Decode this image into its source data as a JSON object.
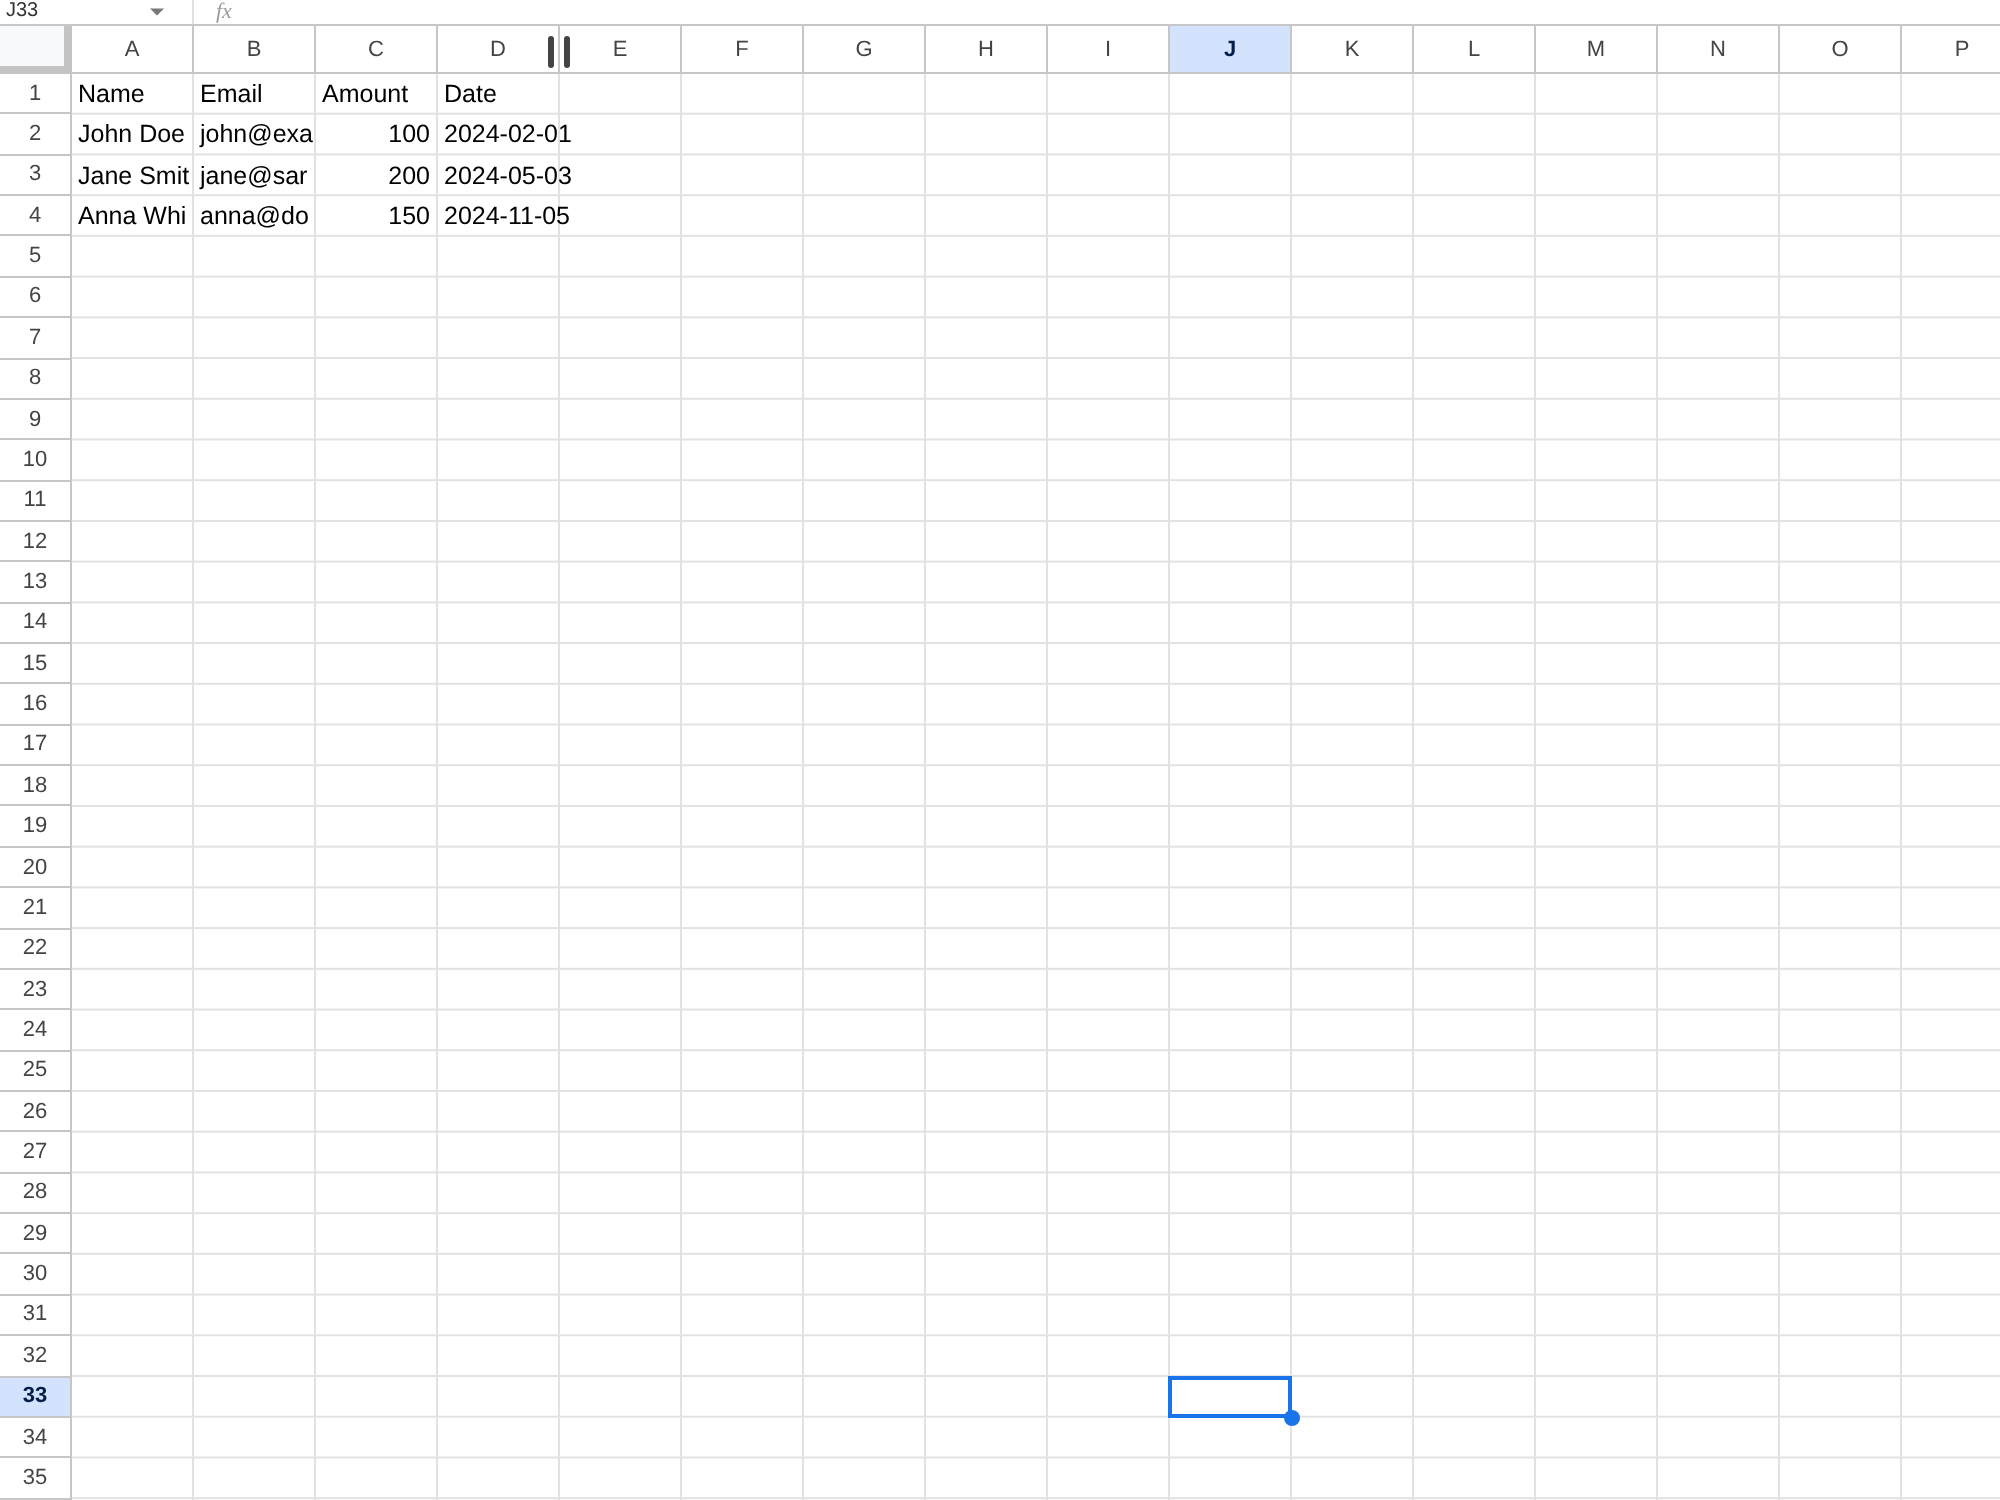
{
  "formula_bar": {
    "name_box": "J33",
    "function_label": "fx"
  },
  "columns": [
    {
      "label": "A",
      "selected": false
    },
    {
      "label": "B",
      "selected": false
    },
    {
      "label": "C",
      "selected": false
    },
    {
      "label": "D",
      "selected": false
    },
    {
      "label": "E",
      "selected": false
    },
    {
      "label": "F",
      "selected": false
    },
    {
      "label": "G",
      "selected": false
    },
    {
      "label": "H",
      "selected": false
    },
    {
      "label": "I",
      "selected": false
    },
    {
      "label": "J",
      "selected": true
    },
    {
      "label": "K",
      "selected": false
    },
    {
      "label": "L",
      "selected": false
    },
    {
      "label": "M",
      "selected": false
    },
    {
      "label": "N",
      "selected": false
    },
    {
      "label": "O",
      "selected": false
    },
    {
      "label": "P",
      "selected": false
    }
  ],
  "rows": [
    {
      "label": "1",
      "selected": false,
      "cells": [
        {
          "text": "Name",
          "kind": "text"
        },
        {
          "text": "Email",
          "kind": "text"
        },
        {
          "text": "Amount",
          "kind": "text"
        },
        {
          "text": "Date",
          "kind": "text"
        }
      ]
    },
    {
      "label": "2",
      "selected": false,
      "cells": [
        {
          "text": "John Doe",
          "kind": "text"
        },
        {
          "text": "john@exa",
          "kind": "text"
        },
        {
          "text": "100",
          "kind": "number"
        },
        {
          "text": "2024-02-01",
          "kind": "text"
        }
      ]
    },
    {
      "label": "3",
      "selected": false,
      "cells": [
        {
          "text": "Jane Smit",
          "kind": "text"
        },
        {
          "text": "jane@sar",
          "kind": "text"
        },
        {
          "text": "200",
          "kind": "number"
        },
        {
          "text": "2024-05-03",
          "kind": "text"
        }
      ]
    },
    {
      "label": "4",
      "selected": false,
      "cells": [
        {
          "text": "Anna Whi",
          "kind": "text"
        },
        {
          "text": "anna@do",
          "kind": "text"
        },
        {
          "text": "150",
          "kind": "number"
        },
        {
          "text": "2024-11-05",
          "kind": "text"
        }
      ]
    },
    {
      "label": "5",
      "selected": false
    },
    {
      "label": "6",
      "selected": false
    },
    {
      "label": "7",
      "selected": false
    },
    {
      "label": "8",
      "selected": false
    },
    {
      "label": "9",
      "selected": false
    },
    {
      "label": "10",
      "selected": false
    },
    {
      "label": "11",
      "selected": false
    },
    {
      "label": "12",
      "selected": false
    },
    {
      "label": "13",
      "selected": false
    },
    {
      "label": "14",
      "selected": false
    },
    {
      "label": "15",
      "selected": false
    },
    {
      "label": "16",
      "selected": false
    },
    {
      "label": "17",
      "selected": false
    },
    {
      "label": "18",
      "selected": false
    },
    {
      "label": "19",
      "selected": false
    },
    {
      "label": "20",
      "selected": false
    },
    {
      "label": "21",
      "selected": false
    },
    {
      "label": "22",
      "selected": false
    },
    {
      "label": "23",
      "selected": false
    },
    {
      "label": "24",
      "selected": false
    },
    {
      "label": "25",
      "selected": false
    },
    {
      "label": "26",
      "selected": false
    },
    {
      "label": "27",
      "selected": false
    },
    {
      "label": "28",
      "selected": false
    },
    {
      "label": "29",
      "selected": false
    },
    {
      "label": "30",
      "selected": false
    },
    {
      "label": "31",
      "selected": false
    },
    {
      "label": "32",
      "selected": false
    },
    {
      "label": "33",
      "selected": true
    },
    {
      "label": "34",
      "selected": false
    },
    {
      "label": "35",
      "selected": false
    }
  ]
}
